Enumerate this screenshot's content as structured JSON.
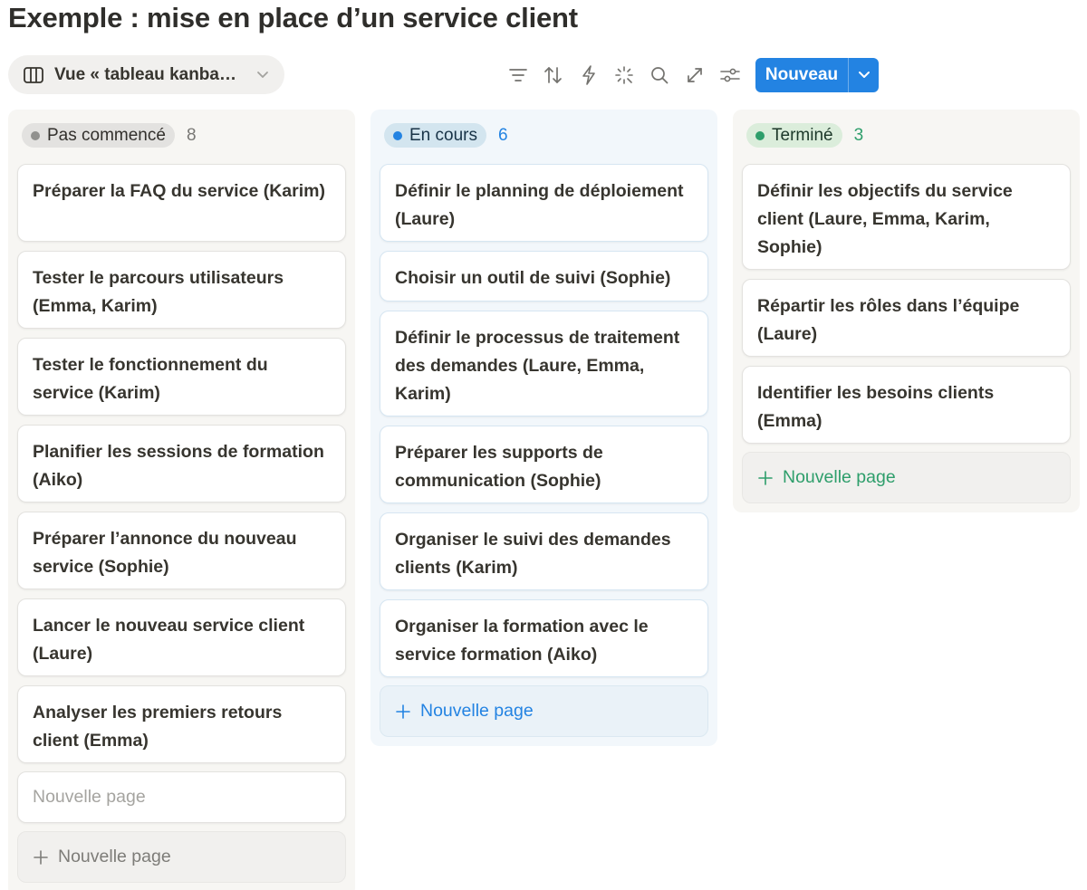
{
  "page": {
    "title": "Exemple : mise en place d’un service client"
  },
  "toolbar": {
    "view_label": "Vue « tableau kanba…",
    "view_icon": "board-view-icon",
    "tools": [
      "filter-icon",
      "sort-icon",
      "automation-bolt-icon",
      "ai-sparkle-icon",
      "search-icon",
      "expand-icon",
      "settings-sliders-icon"
    ],
    "new_label": "Nouveau",
    "accent": "#2383e2"
  },
  "columns": [
    {
      "status": "Pas commencé",
      "count": "8",
      "color": "#91918e",
      "cards": [
        "Préparer la FAQ du service (Karim)",
        "Tester le parcours utilisateurs (Emma, Karim)",
        "Tester le fonctionnement du service (Karim)",
        "Planifier les sessions de formation (Aiko)",
        "Préparer l’annonce du nouveau service (Sophie)",
        "Lancer le nouveau service client (Laure)",
        "Analyser les premiers retours client (Emma)"
      ],
      "placeholder_card": "Nouvelle page",
      "add_label": "Nouvelle page"
    },
    {
      "status": "En cours",
      "count": "6",
      "color": "#2383e2",
      "cards": [
        "Définir le planning de déploiement (Laure)",
        "Choisir un outil de suivi (Sophie)",
        "Définir le processus de traitement des demandes (Laure, Emma, Karim)",
        "Préparer les supports de communication (Sophie)",
        "Organiser le suivi des demandes clients (Karim)",
        "Organiser la formation avec le service formation (Aiko)"
      ],
      "add_label": "Nouvelle page"
    },
    {
      "status": "Terminé",
      "count": "3",
      "color": "#2e9e6b",
      "cards": [
        "Définir les objectifs du service client (Laure, Emma, Karim, Sophie)",
        "Répartir les rôles dans l’équipe (Laure)",
        "Identifier les besoins clients (Emma)"
      ],
      "add_label": "Nouvelle page"
    }
  ]
}
